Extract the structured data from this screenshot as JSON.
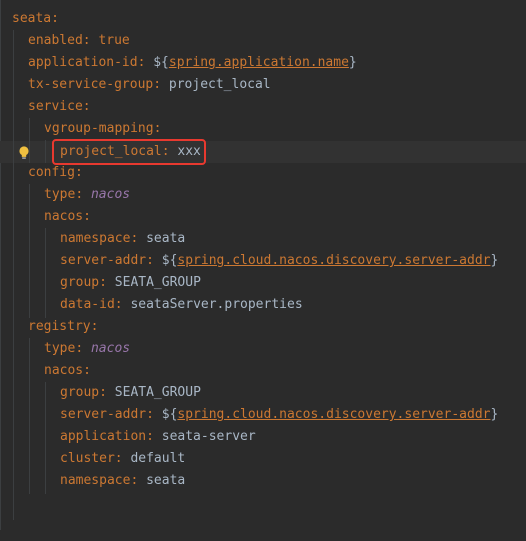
{
  "lines": [
    {
      "key": "seata",
      "sep": ":",
      "value": ""
    },
    {
      "key": "enabled",
      "sep": ": ",
      "value": "true"
    },
    {
      "key": "application-id",
      "sep": ": ",
      "pre": "${",
      "link": "spring.application.name",
      "post": "}"
    },
    {
      "key": "tx-service-group",
      "sep": ": ",
      "value": "project_local"
    },
    {
      "key": "service",
      "sep": ":",
      "value": ""
    },
    {
      "key": "vgroup-mapping",
      "sep": ":",
      "value": ""
    },
    {
      "key": "project_local",
      "sep": ": ",
      "value": "xxx"
    },
    {
      "key": "config",
      "sep": ":",
      "value": ""
    },
    {
      "key": "type",
      "sep": ": ",
      "italic": "nacos"
    },
    {
      "key": "nacos",
      "sep": ":",
      "value": ""
    },
    {
      "key": "namespace",
      "sep": ": ",
      "value": "seata"
    },
    {
      "key": "server-addr",
      "sep": ": ",
      "pre": "${",
      "link": "spring.cloud.nacos.discovery.server-addr",
      "post": "}"
    },
    {
      "key": "group",
      "sep": ": ",
      "value": "SEATA_GROUP"
    },
    {
      "key": "data-id",
      "sep": ": ",
      "value": "seataServer.properties"
    },
    {
      "key": "registry",
      "sep": ":",
      "value": ""
    },
    {
      "key": "type",
      "sep": ": ",
      "italic": "nacos"
    },
    {
      "key": "nacos",
      "sep": ":",
      "value": ""
    },
    {
      "key": "group",
      "sep": ": ",
      "value": "SEATA_GROUP"
    },
    {
      "key": "server-addr",
      "sep": ": ",
      "pre": "${",
      "link": "spring.cloud.nacos.discovery.server-addr",
      "post": "}"
    },
    {
      "key": "application",
      "sep": ": ",
      "value": "seata-server"
    },
    {
      "key": "cluster",
      "sep": ": ",
      "value": "default"
    },
    {
      "key": "namespace",
      "sep": ": ",
      "value": "seata"
    }
  ],
  "colors": {
    "background": "#2b2b2b",
    "key": "#cc7832",
    "value": "#a9b7c6",
    "italic_value": "#9876aa",
    "highlight_border": "#e8392f",
    "bulb": "#f0c040"
  },
  "icons": {
    "gutter_hint": "lightbulb-icon"
  }
}
